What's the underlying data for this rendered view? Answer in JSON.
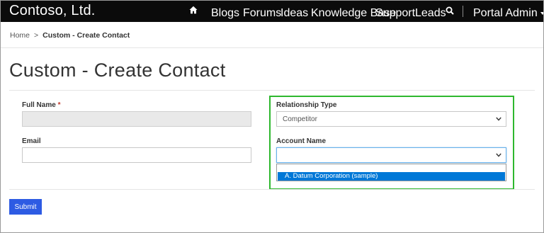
{
  "header": {
    "brand": "Contoso, Ltd.",
    "nav_items": [
      "Blogs",
      "Forums",
      "Ideas",
      "Knowledge Base",
      "Support",
      "Leads"
    ],
    "user_menu": "Portal Admin",
    "icons": {
      "home": "home-icon",
      "search": "search-icon",
      "user_menu_caret": "caret-down-icon"
    }
  },
  "breadcrumb": {
    "home": "Home",
    "separator": ">",
    "current": "Custom - Create Contact"
  },
  "page": {
    "title": "Custom - Create Contact"
  },
  "form": {
    "full_name": {
      "label": "Full Name",
      "required_marker": "*",
      "value": ""
    },
    "email": {
      "label": "Email",
      "value": ""
    },
    "relationship_type": {
      "label": "Relationship Type",
      "selected": "Competitor"
    },
    "account_name": {
      "label": "Account Name",
      "selected": "",
      "options": [
        "A. Datum Corporation (sample)"
      ]
    },
    "submit_label": "Submit"
  },
  "colors": {
    "navbar_bg": "#0b0b0b",
    "highlight_border": "#2eb82e",
    "option_highlight": "#0078d7",
    "submit_bg": "#2d5be3"
  }
}
